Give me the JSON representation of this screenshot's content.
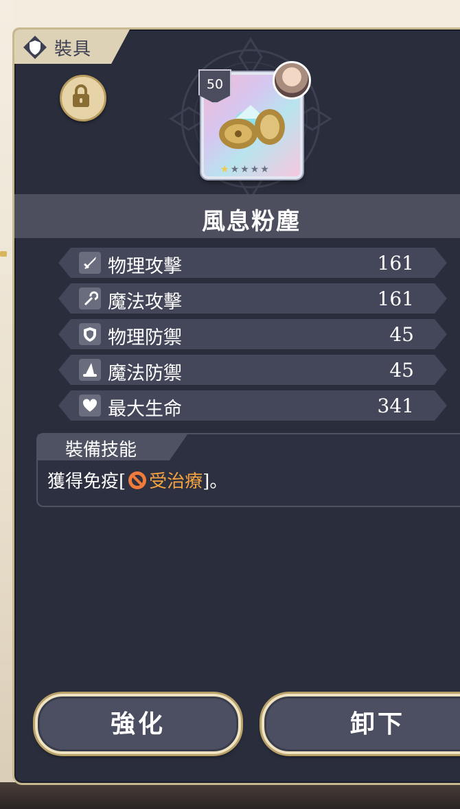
{
  "header": {
    "tab_label": "裝具"
  },
  "item": {
    "level": "50",
    "name": "風息粉塵",
    "stars_total": 5,
    "stars_filled": 1
  },
  "stats": [
    {
      "icon": "sword-icon",
      "label": "物理攻擊",
      "value": "161"
    },
    {
      "icon": "staff-icon",
      "label": "魔法攻擊",
      "value": "161"
    },
    {
      "icon": "shield-icon",
      "label": "物理防禦",
      "value": "45"
    },
    {
      "icon": "wizard-hat-icon",
      "label": "魔法防禦",
      "value": "45"
    },
    {
      "icon": "heart-icon",
      "label": "最大生命",
      "value": "341"
    }
  ],
  "skill": {
    "title": "裝備技能",
    "prefix": "獲得免疫[",
    "effect": "受治療",
    "suffix": "]。"
  },
  "buttons": {
    "enhance": "強化",
    "unequip": "卸下"
  },
  "colors": {
    "panel": "#2a2d3c",
    "gold_border": "#c9b98f",
    "effect_text": "#f3a340"
  }
}
